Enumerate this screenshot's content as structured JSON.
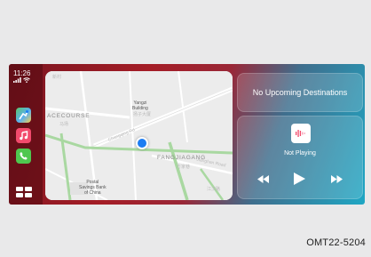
{
  "status_bar": {
    "time": "11:26",
    "signal": "▌▌",
    "wifi": "◠"
  },
  "dock": {
    "apps": [
      {
        "name": "Maps",
        "glyph": "↗"
      },
      {
        "name": "Music",
        "glyph": "♫"
      },
      {
        "name": "Phone",
        "glyph": "☎"
      }
    ]
  },
  "map": {
    "labels": {
      "racecourse": "ACECOURSE",
      "racecourse_cn": "马场",
      "yangzi": "Yangzi\nBuilding",
      "yangzi_cn": "扬子大厦",
      "changqing_rd": "Changqing Rd",
      "fangjiagang": "FANGJIAGANG",
      "fangjiagang_cn": "方家巷",
      "postal": "Postal\nSavings Bank\nof China",
      "jianghan_rd": "Jianghan Road",
      "top_left_cn": "新村",
      "bottom_right_cn": "江汉路"
    }
  },
  "destinations": {
    "text": "No Upcoming Destinations"
  },
  "now_playing": {
    "status": "Not Playing",
    "controls": {
      "rewind": "◀◀",
      "play": "▶",
      "forward": "▶▶"
    }
  },
  "figure_code": "OMT22-5204",
  "colors": {
    "accent_red": "#a41d26",
    "accent_teal": "#1fa7c4",
    "location_blue": "#1d7df2",
    "music_pink": "#f24a6c"
  }
}
